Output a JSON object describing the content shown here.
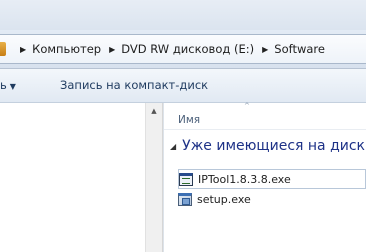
{
  "address_bar": {
    "breadcrumbs": [
      "Компьютер",
      "DVD RW дисковод (E:)",
      "Software"
    ]
  },
  "toolbar": {
    "left_label": "ь",
    "burn_label": "Запись на компакт-диск"
  },
  "column_header": {
    "name": "Имя"
  },
  "group": {
    "label": "Уже имеющиеся на диск"
  },
  "files": [
    {
      "name": "IPTool1.8.3.8.exe",
      "icon": "exe-icon",
      "selected": true
    },
    {
      "name": "setup.exe",
      "icon": "setup-icon",
      "selected": false
    }
  ]
}
